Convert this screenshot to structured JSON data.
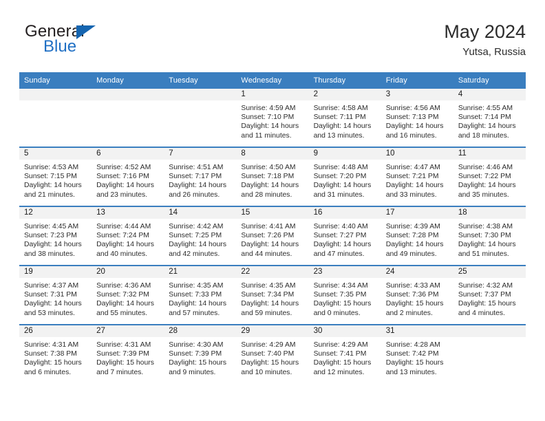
{
  "brand": {
    "word_one": "General",
    "word_two": "Blue",
    "triangle_color": "#1565b0",
    "blue_text_color": "#1f6fc4"
  },
  "header": {
    "month_title": "May 2024",
    "location": "Yutsa, Russia"
  },
  "theme": {
    "header_row_bg": "#3a7ebf",
    "daynum_band_bg": "#f2f2f2",
    "row_divider": "#3a7ebf",
    "page_bg": "#ffffff"
  },
  "weekday_headers": [
    "Sunday",
    "Monday",
    "Tuesday",
    "Wednesday",
    "Thursday",
    "Friday",
    "Saturday"
  ],
  "labels": {
    "sunrise_prefix": "Sunrise:",
    "sunset_prefix": "Sunset:",
    "daylight_prefix": "Daylight:"
  },
  "weeks": [
    [
      {
        "day": "",
        "empty": true
      },
      {
        "day": "",
        "empty": true
      },
      {
        "day": "",
        "empty": true
      },
      {
        "day": "1",
        "sunrise": "Sunrise: 4:59 AM",
        "sunset": "Sunset: 7:10 PM",
        "daylight": "Daylight: 14 hours and 11 minutes."
      },
      {
        "day": "2",
        "sunrise": "Sunrise: 4:58 AM",
        "sunset": "Sunset: 7:11 PM",
        "daylight": "Daylight: 14 hours and 13 minutes."
      },
      {
        "day": "3",
        "sunrise": "Sunrise: 4:56 AM",
        "sunset": "Sunset: 7:13 PM",
        "daylight": "Daylight: 14 hours and 16 minutes."
      },
      {
        "day": "4",
        "sunrise": "Sunrise: 4:55 AM",
        "sunset": "Sunset: 7:14 PM",
        "daylight": "Daylight: 14 hours and 18 minutes."
      }
    ],
    [
      {
        "day": "5",
        "sunrise": "Sunrise: 4:53 AM",
        "sunset": "Sunset: 7:15 PM",
        "daylight": "Daylight: 14 hours and 21 minutes."
      },
      {
        "day": "6",
        "sunrise": "Sunrise: 4:52 AM",
        "sunset": "Sunset: 7:16 PM",
        "daylight": "Daylight: 14 hours and 23 minutes."
      },
      {
        "day": "7",
        "sunrise": "Sunrise: 4:51 AM",
        "sunset": "Sunset: 7:17 PM",
        "daylight": "Daylight: 14 hours and 26 minutes."
      },
      {
        "day": "8",
        "sunrise": "Sunrise: 4:50 AM",
        "sunset": "Sunset: 7:18 PM",
        "daylight": "Daylight: 14 hours and 28 minutes."
      },
      {
        "day": "9",
        "sunrise": "Sunrise: 4:48 AM",
        "sunset": "Sunset: 7:20 PM",
        "daylight": "Daylight: 14 hours and 31 minutes."
      },
      {
        "day": "10",
        "sunrise": "Sunrise: 4:47 AM",
        "sunset": "Sunset: 7:21 PM",
        "daylight": "Daylight: 14 hours and 33 minutes."
      },
      {
        "day": "11",
        "sunrise": "Sunrise: 4:46 AM",
        "sunset": "Sunset: 7:22 PM",
        "daylight": "Daylight: 14 hours and 35 minutes."
      }
    ],
    [
      {
        "day": "12",
        "sunrise": "Sunrise: 4:45 AM",
        "sunset": "Sunset: 7:23 PM",
        "daylight": "Daylight: 14 hours and 38 minutes."
      },
      {
        "day": "13",
        "sunrise": "Sunrise: 4:44 AM",
        "sunset": "Sunset: 7:24 PM",
        "daylight": "Daylight: 14 hours and 40 minutes."
      },
      {
        "day": "14",
        "sunrise": "Sunrise: 4:42 AM",
        "sunset": "Sunset: 7:25 PM",
        "daylight": "Daylight: 14 hours and 42 minutes."
      },
      {
        "day": "15",
        "sunrise": "Sunrise: 4:41 AM",
        "sunset": "Sunset: 7:26 PM",
        "daylight": "Daylight: 14 hours and 44 minutes."
      },
      {
        "day": "16",
        "sunrise": "Sunrise: 4:40 AM",
        "sunset": "Sunset: 7:27 PM",
        "daylight": "Daylight: 14 hours and 47 minutes."
      },
      {
        "day": "17",
        "sunrise": "Sunrise: 4:39 AM",
        "sunset": "Sunset: 7:28 PM",
        "daylight": "Daylight: 14 hours and 49 minutes."
      },
      {
        "day": "18",
        "sunrise": "Sunrise: 4:38 AM",
        "sunset": "Sunset: 7:30 PM",
        "daylight": "Daylight: 14 hours and 51 minutes."
      }
    ],
    [
      {
        "day": "19",
        "sunrise": "Sunrise: 4:37 AM",
        "sunset": "Sunset: 7:31 PM",
        "daylight": "Daylight: 14 hours and 53 minutes."
      },
      {
        "day": "20",
        "sunrise": "Sunrise: 4:36 AM",
        "sunset": "Sunset: 7:32 PM",
        "daylight": "Daylight: 14 hours and 55 minutes."
      },
      {
        "day": "21",
        "sunrise": "Sunrise: 4:35 AM",
        "sunset": "Sunset: 7:33 PM",
        "daylight": "Daylight: 14 hours and 57 minutes."
      },
      {
        "day": "22",
        "sunrise": "Sunrise: 4:35 AM",
        "sunset": "Sunset: 7:34 PM",
        "daylight": "Daylight: 14 hours and 59 minutes."
      },
      {
        "day": "23",
        "sunrise": "Sunrise: 4:34 AM",
        "sunset": "Sunset: 7:35 PM",
        "daylight": "Daylight: 15 hours and 0 minutes."
      },
      {
        "day": "24",
        "sunrise": "Sunrise: 4:33 AM",
        "sunset": "Sunset: 7:36 PM",
        "daylight": "Daylight: 15 hours and 2 minutes."
      },
      {
        "day": "25",
        "sunrise": "Sunrise: 4:32 AM",
        "sunset": "Sunset: 7:37 PM",
        "daylight": "Daylight: 15 hours and 4 minutes."
      }
    ],
    [
      {
        "day": "26",
        "sunrise": "Sunrise: 4:31 AM",
        "sunset": "Sunset: 7:38 PM",
        "daylight": "Daylight: 15 hours and 6 minutes."
      },
      {
        "day": "27",
        "sunrise": "Sunrise: 4:31 AM",
        "sunset": "Sunset: 7:39 PM",
        "daylight": "Daylight: 15 hours and 7 minutes."
      },
      {
        "day": "28",
        "sunrise": "Sunrise: 4:30 AM",
        "sunset": "Sunset: 7:39 PM",
        "daylight": "Daylight: 15 hours and 9 minutes."
      },
      {
        "day": "29",
        "sunrise": "Sunrise: 4:29 AM",
        "sunset": "Sunset: 7:40 PM",
        "daylight": "Daylight: 15 hours and 10 minutes."
      },
      {
        "day": "30",
        "sunrise": "Sunrise: 4:29 AM",
        "sunset": "Sunset: 7:41 PM",
        "daylight": "Daylight: 15 hours and 12 minutes."
      },
      {
        "day": "31",
        "sunrise": "Sunrise: 4:28 AM",
        "sunset": "Sunset: 7:42 PM",
        "daylight": "Daylight: 15 hours and 13 minutes."
      },
      {
        "day": "",
        "empty": true
      }
    ]
  ]
}
